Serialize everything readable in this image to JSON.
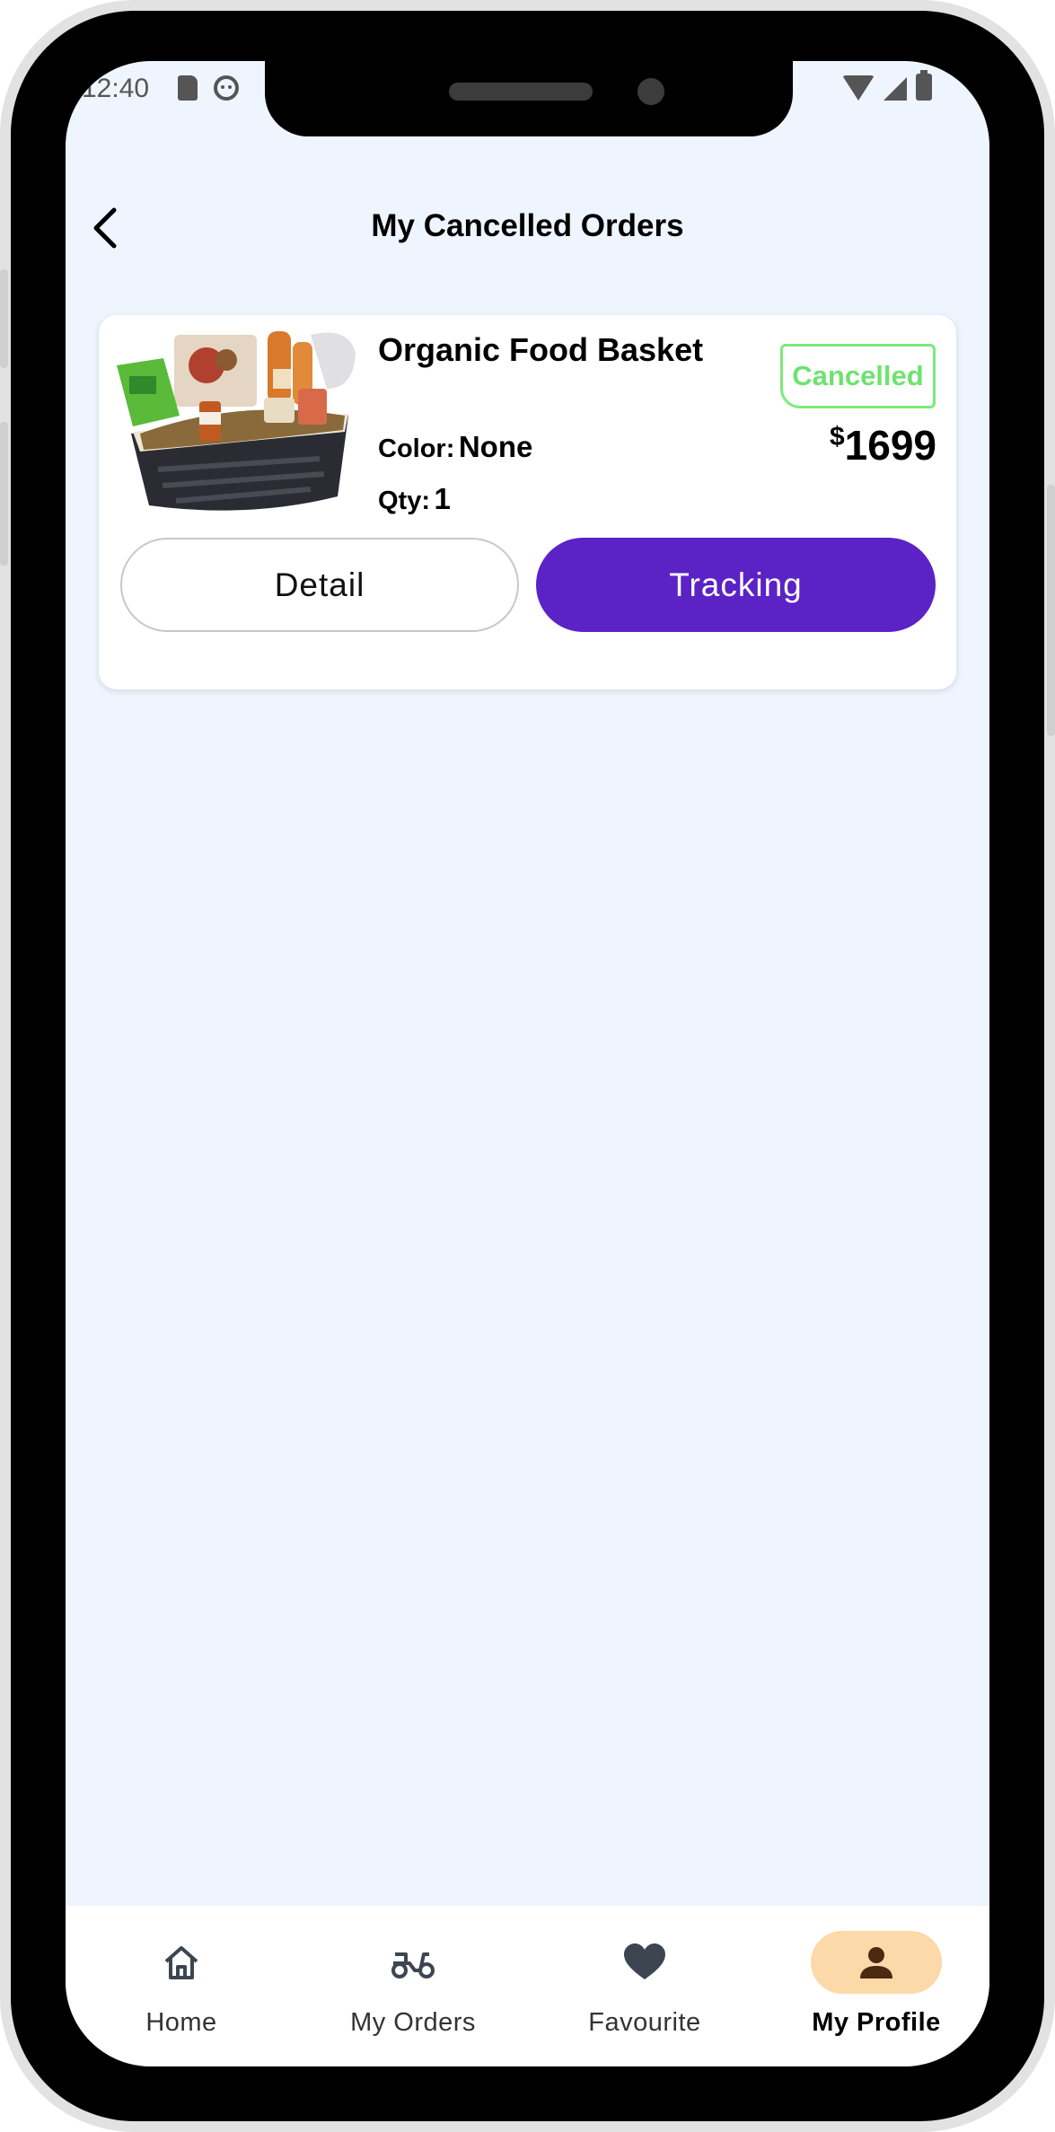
{
  "status_bar": {
    "time": "12:40"
  },
  "header": {
    "title": "My Cancelled Orders"
  },
  "order": {
    "product_name": "Organic Food Basket",
    "status": "Cancelled",
    "color_label": "Color:",
    "color_value": "None",
    "qty_label": "Qty:",
    "qty_value": "1",
    "currency": "$",
    "price": "1699",
    "detail_label": "Detail",
    "tracking_label": "Tracking"
  },
  "bottom_nav": {
    "items": [
      {
        "label": "Home",
        "icon": "home-icon"
      },
      {
        "label": "My Orders",
        "icon": "scooter-icon"
      },
      {
        "label": "Favourite",
        "icon": "heart-icon"
      },
      {
        "label": "My Profile",
        "icon": "person-icon",
        "active": true
      }
    ]
  },
  "colors": {
    "background": "#eef5fe",
    "accent": "#5b22c5",
    "cancelled": "#6fe26f",
    "active_nav": "#fcd9a8"
  }
}
